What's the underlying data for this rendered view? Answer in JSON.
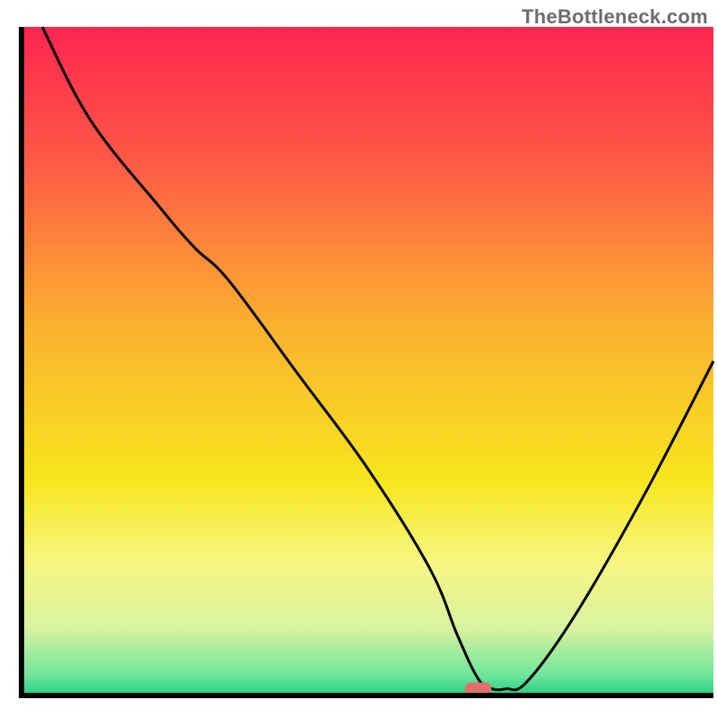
{
  "watermark": "TheBottleneck.com",
  "chart_data": {
    "type": "line",
    "title": "",
    "xlabel": "",
    "ylabel": "",
    "xlim": [
      0,
      100
    ],
    "ylim": [
      0,
      100
    ],
    "x": [
      3,
      10,
      20,
      25,
      30,
      40,
      50,
      59,
      63,
      66,
      68,
      70,
      73,
      80,
      90,
      100
    ],
    "values": [
      100,
      86,
      73,
      67,
      62,
      48,
      34,
      19,
      9,
      2.5,
      1,
      1,
      2,
      12,
      30,
      50
    ],
    "marker": {
      "x": 66,
      "y": 1,
      "color": "#e36f6a"
    },
    "gradient_stops": [
      {
        "offset": 0.0,
        "color": "#fe2550"
      },
      {
        "offset": 0.2,
        "color": "#fd5945"
      },
      {
        "offset": 0.45,
        "color": "#fbb22f"
      },
      {
        "offset": 0.68,
        "color": "#f7e61d"
      },
      {
        "offset": 0.8,
        "color": "#f7f680"
      },
      {
        "offset": 0.9,
        "color": "#d8f3a0"
      },
      {
        "offset": 0.97,
        "color": "#6de59a"
      },
      {
        "offset": 1.0,
        "color": "#22d081"
      }
    ],
    "axis_color": "#000000"
  }
}
